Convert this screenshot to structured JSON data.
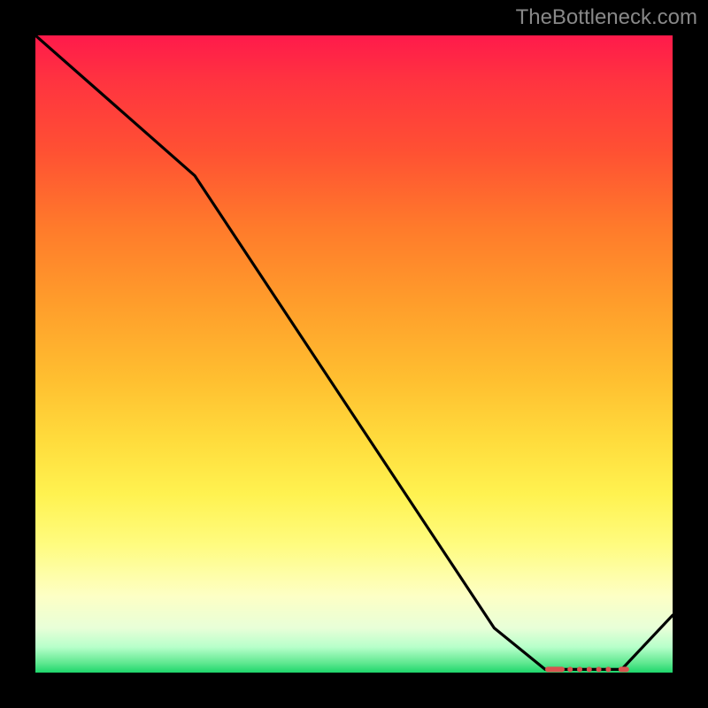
{
  "attribution": "TheBottleneck.com",
  "chart_data": {
    "type": "line",
    "title": "",
    "xlabel": "",
    "ylabel": "",
    "xlim": [
      0,
      1
    ],
    "ylim": [
      0,
      1
    ],
    "x": [
      0.0,
      0.25,
      0.72,
      0.8,
      0.88,
      0.92,
      1.0
    ],
    "values": [
      1.0,
      0.78,
      0.07,
      0.005,
      0.005,
      0.005,
      0.09
    ],
    "series_name": "bottleneck-curve",
    "optimum_region_x": [
      0.8,
      0.92
    ],
    "curve_color": "#000000",
    "dot_color": "#d9534f",
    "gradient_stops": [
      {
        "pos": 0.0,
        "color": "#ff1a4b"
      },
      {
        "pos": 0.3,
        "color": "#ff7a2b"
      },
      {
        "pos": 0.64,
        "color": "#ffdd3d"
      },
      {
        "pos": 0.88,
        "color": "#fdffc5"
      },
      {
        "pos": 1.0,
        "color": "#1ed66b"
      }
    ]
  }
}
